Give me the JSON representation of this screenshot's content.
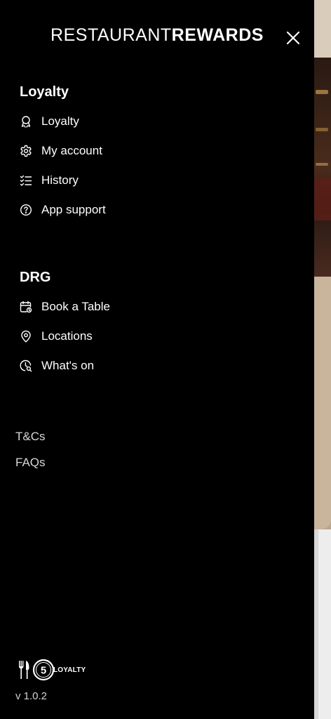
{
  "header": {
    "brand_light": "RESTAURANT",
    "brand_bold": "REWARDS"
  },
  "sections": [
    {
      "title": "Loyalty",
      "items": [
        {
          "label": "Loyalty",
          "icon": "award-icon"
        },
        {
          "label": "My account",
          "icon": "gear-icon"
        },
        {
          "label": "History",
          "icon": "checklist-icon"
        },
        {
          "label": "App support",
          "icon": "help-circle-icon"
        }
      ]
    },
    {
      "title": "DRG",
      "items": [
        {
          "label": "Book a Table",
          "icon": "calendar-icon"
        },
        {
          "label": "Locations",
          "icon": "location-pin-icon"
        },
        {
          "label": "What's on",
          "icon": "clock-search-icon"
        }
      ]
    }
  ],
  "footer": {
    "links": [
      "T&Cs",
      "FAQs"
    ],
    "logo_number": "5",
    "logo_text": "LOYALTY",
    "version": "v 1.0.2"
  },
  "colors": {
    "drawer_bg": "#000000",
    "text": "#ffffff",
    "muted_text": "#d8d8d8"
  }
}
